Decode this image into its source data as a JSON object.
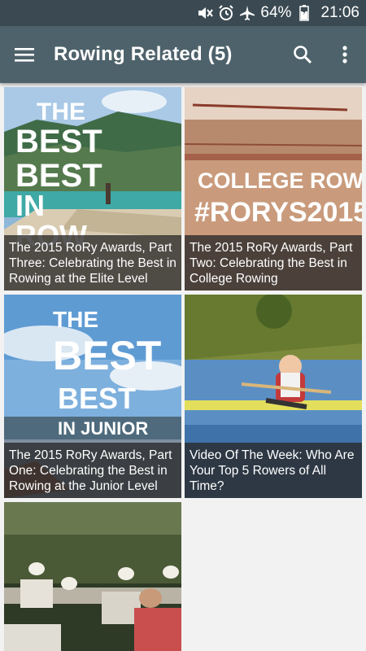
{
  "status_bar": {
    "battery": "64%",
    "time": "21:06",
    "icons": [
      "mute-icon",
      "alarm-icon",
      "airplane-icon",
      "battery-icon"
    ]
  },
  "app_bar": {
    "title": "Rowing Related (5)",
    "icons": [
      "hamburger-menu-icon",
      "search-icon",
      "overflow-menu-icon"
    ]
  },
  "cards": [
    {
      "caption": "The 2015 RoRy Awards, Part Three: Celebrating the Best in Rowing at the Elite Level",
      "thumb_text": [
        "THE",
        "BEST",
        "IN",
        "ROW"
      ]
    },
    {
      "caption": "The 2015 RoRy Awards, Part Two: Celebrating the Best in College Rowing",
      "thumb_text": [
        "COLLEGE ROWING",
        "#RORYS2015"
      ]
    },
    {
      "caption": "The 2015 RoRy Awards, Part One: Celebrating the Best in Rowing at the Junior Level",
      "thumb_text": [
        "THE",
        "BEST",
        "BEST",
        "IN JUNIOR"
      ]
    },
    {
      "caption": "Video Of The Week: Who Are Your Top 5 Rowers of All Time?"
    },
    {
      "caption": ""
    }
  ],
  "colors": {
    "status_bar": "#3b4a52",
    "app_bar": "#4e626b",
    "background": "#f2f2f2",
    "caption_overlay": "#282828"
  }
}
